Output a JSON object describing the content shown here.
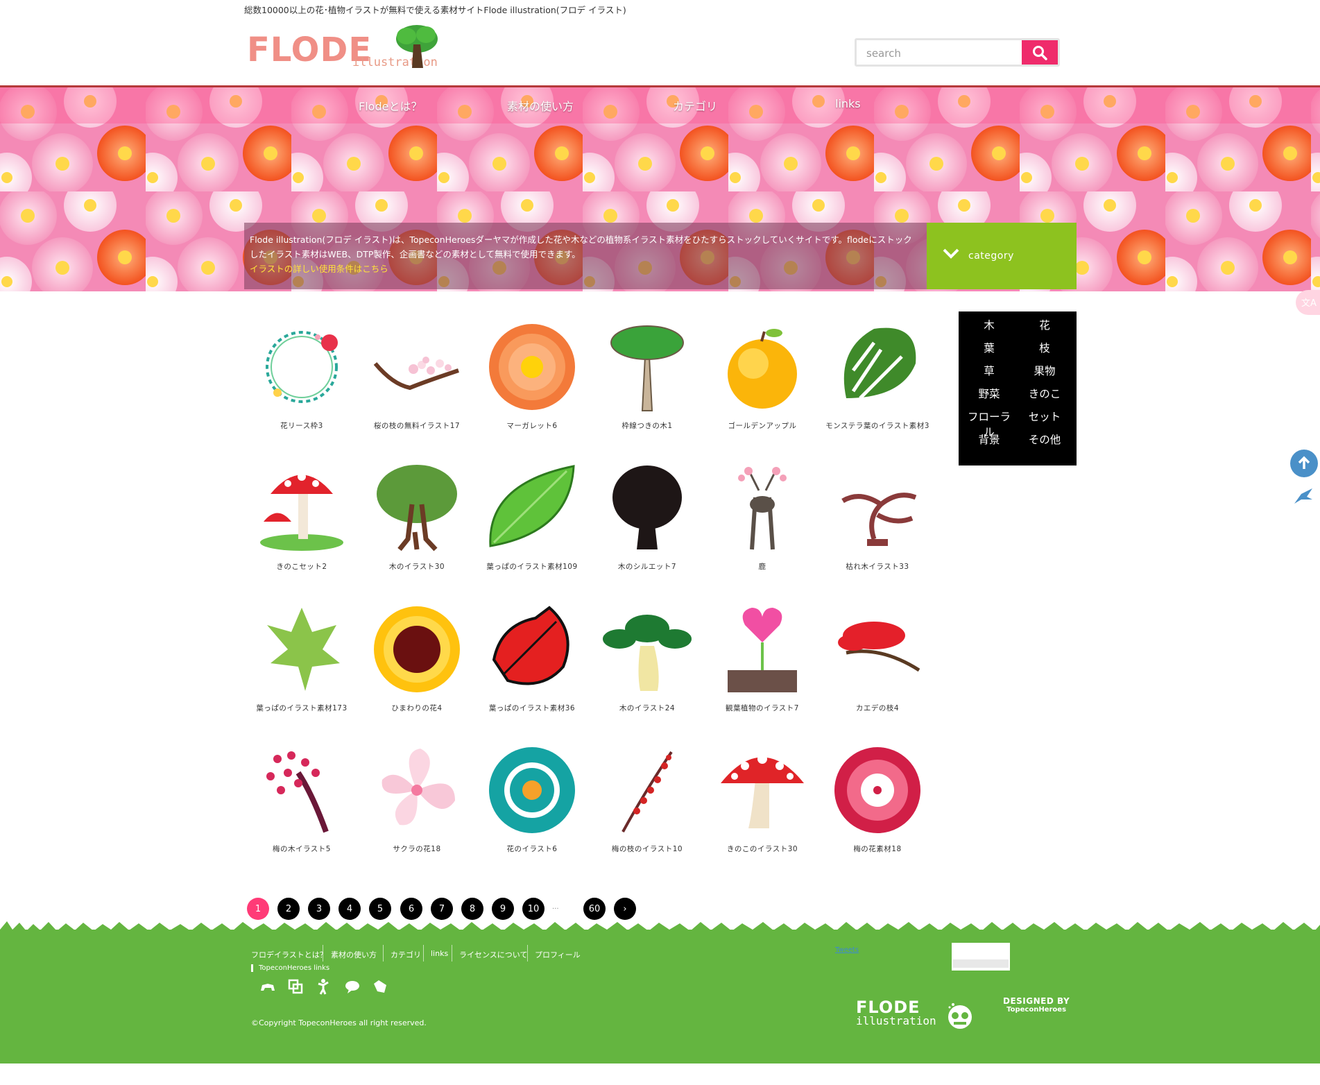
{
  "header": {
    "tagline": "総数10000以上の花･植物イラストが無料で使える素材サイトFlode illustration(フロデ イラスト)",
    "logo_main": "FLODE",
    "logo_sub": "illustration",
    "search_placeholder": "search"
  },
  "nav": {
    "items": [
      {
        "label": "Flodeとは？"
      },
      {
        "label": "素材の使い方"
      },
      {
        "label": "カテゴリ"
      },
      {
        "label": "links"
      }
    ]
  },
  "intro": {
    "text": "Flode illustration(フロデ イラスト)は、TopeconHeroesダーヤマが作成した花や木などの植物系イラスト素材をひたすらストックしていくサイトです。flodeにストックしたイラスト素材はWEB、DTP製作、企画書などの素材として無料で使用できます。",
    "link": "イラストの詳しい使用条件はこちら"
  },
  "category_button": {
    "label": "category"
  },
  "categories": [
    "木",
    "花",
    "葉",
    "枝",
    "草",
    "果物",
    "野菜",
    "きのこ",
    "フローラル",
    "セット",
    "背景",
    "その他"
  ],
  "items": [
    {
      "label": "花リース枠3",
      "icon": "wreath-icon"
    },
    {
      "label": "桜の枝の無料イラスト17",
      "icon": "cherry-branch-icon"
    },
    {
      "label": "マーガレット6",
      "icon": "orange-flower-icon"
    },
    {
      "label": "枠線つきの木1",
      "icon": "outlined-tree-icon"
    },
    {
      "label": "ゴールデンアップル",
      "icon": "golden-apple-icon"
    },
    {
      "label": "モンステラ葉のイラスト素材3",
      "icon": "monstera-leaf-icon"
    },
    {
      "label": "きのこセット2",
      "icon": "mushroom-set-icon"
    },
    {
      "label": "木のイラスト30",
      "icon": "tree-with-roots-icon"
    },
    {
      "label": "葉っぱのイラスト素材109",
      "icon": "green-leaf-icon"
    },
    {
      "label": "木のシルエット7",
      "icon": "tree-silhouette-icon"
    },
    {
      "label": "鹿",
      "icon": "deer-icon"
    },
    {
      "label": "枯れ木イラスト33",
      "icon": "dead-tree-icon"
    },
    {
      "label": "葉っぱのイラスト素材173",
      "icon": "maple-leaf-icon"
    },
    {
      "label": "ひまわりの花4",
      "icon": "sunflower-icon"
    },
    {
      "label": "葉っぱのイラスト素材36",
      "icon": "red-leaf-icon"
    },
    {
      "label": "木のイラスト24",
      "icon": "pine-tree-icon"
    },
    {
      "label": "観葉植物のイラスト7",
      "icon": "heart-plant-icon"
    },
    {
      "label": "カエデの枝4",
      "icon": "maple-branch-icon"
    },
    {
      "label": "梅の木イラスト5",
      "icon": "plum-tree-icon"
    },
    {
      "label": "サクラの花18",
      "icon": "sakura-flower-icon"
    },
    {
      "label": "花のイラスト6",
      "icon": "teal-flower-icon"
    },
    {
      "label": "梅の枝のイラスト10",
      "icon": "plum-branch-icon"
    },
    {
      "label": "きのこのイラスト30",
      "icon": "red-mushroom-icon"
    },
    {
      "label": "梅の花素材18",
      "icon": "plum-blossom-icon"
    }
  ],
  "pagination": {
    "pages": [
      "1",
      "2",
      "3",
      "4",
      "5",
      "6",
      "7",
      "8",
      "9",
      "10"
    ],
    "ellipsis": "...",
    "last": "60",
    "next": "›",
    "current": "1"
  },
  "footer": {
    "links": [
      "フロデイラストとは？",
      "素材の使い方",
      "カテゴリ",
      "links",
      "ライセンスについて",
      "プロフィール"
    ],
    "topecon_links": "TopeconHeroes links",
    "copyright": "©Copyright TopeconHeroes all right reserved.",
    "twitter": "Tweets",
    "flode_logo_main": "FLODE",
    "flode_logo_sub": "illustration",
    "designed_by": "DESIGNED BY",
    "designer": "TopeconHeroes"
  },
  "colors": {
    "accent_pink": "#ef2b6b",
    "category_green": "#8dc21f",
    "footer_green": "#64b540",
    "hero_pink": "#f78bb5"
  }
}
